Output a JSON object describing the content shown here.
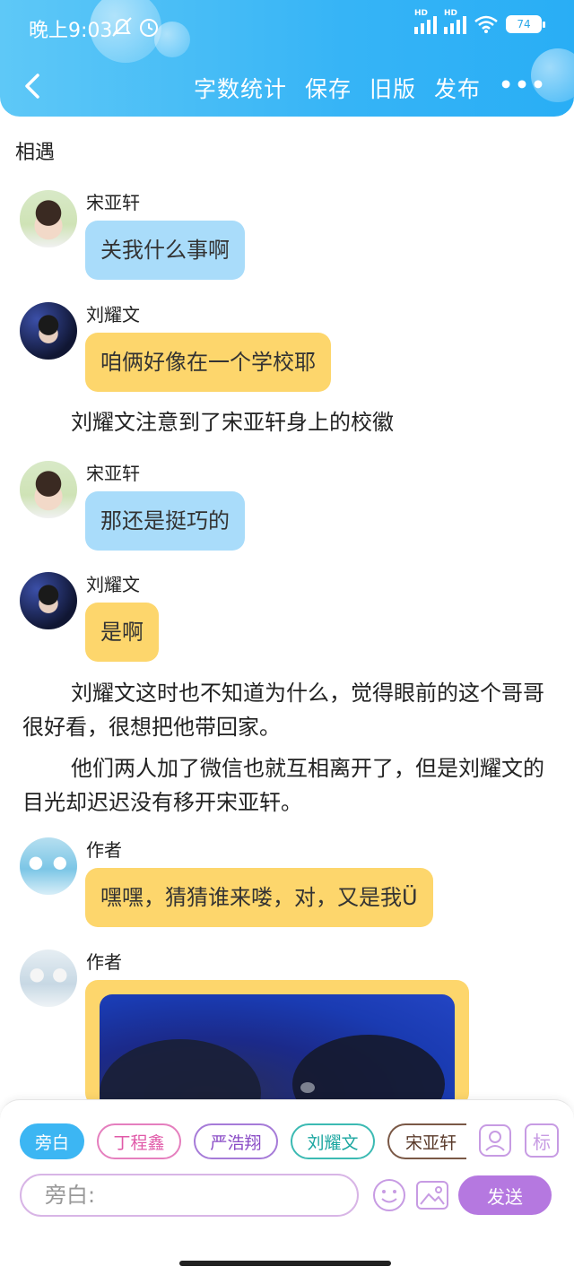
{
  "status_bar": {
    "time": "晚上9:03",
    "signal_tag": "HD",
    "battery": "74"
  },
  "toolbar": {
    "back_icon": "chevron-left-icon",
    "actions": [
      "字数统计",
      "保存",
      "旧版",
      "发布"
    ],
    "more": "•••"
  },
  "chapter": {
    "title": "相遇"
  },
  "messages": [
    {
      "sender": "宋亚轩",
      "text": "关我什么事啊",
      "color": "#a9dcfa"
    },
    {
      "sender": "刘耀文",
      "text": "咱俩好像在一个学校耶",
      "color": "#fdd66c"
    },
    {
      "sender": "宋亚轩",
      "text": "那还是挺巧的",
      "color": "#a9dcfa"
    },
    {
      "sender": "刘耀文",
      "text": "是啊",
      "color": "#fdd66c"
    },
    {
      "sender": "作者",
      "text": "嘿嘿，猜猜谁来喽，对，又是我Ü",
      "color": "#fdd66c"
    },
    {
      "sender": "作者"
    }
  ],
  "narrations": [
    "刘耀文注意到了宋亚轩身上的校徽",
    "刘耀文这时也不知道为什么，觉得眼前的这个哥哥很好看，很想把他带回家。",
    "他们两人加了微信也就互相离开了，但是刘耀文的目光却迟迟没有移开宋亚轩。"
  ],
  "composer": {
    "roles": [
      "旁白",
      "丁程鑫",
      "严浩翔",
      "刘耀文",
      "宋亚轩"
    ],
    "mark_label": "标",
    "input_placeholder": "旁白:",
    "send_label": "发送"
  }
}
